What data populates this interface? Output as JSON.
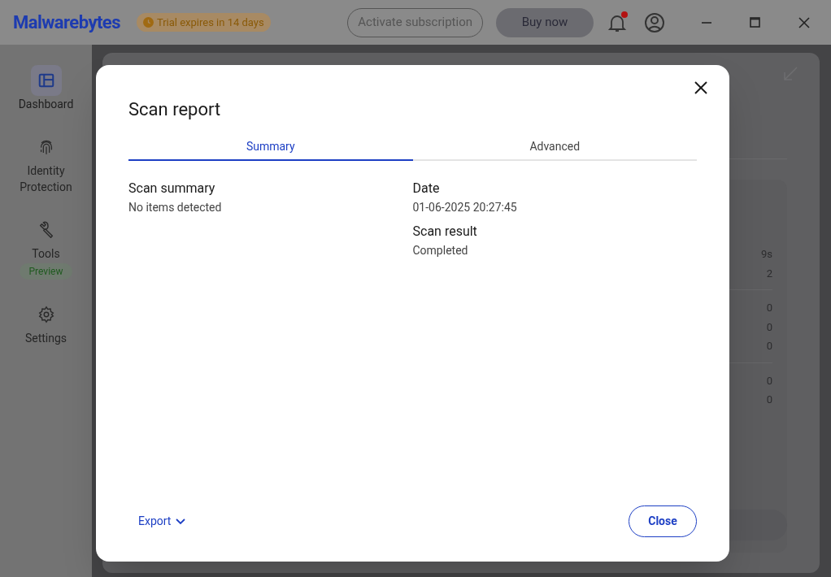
{
  "header": {
    "logo": "Malwarebytes",
    "trial_badge": "Trial expires in 14 days",
    "activate_button": "Activate subscription",
    "buy_button": "Buy now",
    "notification_unread": true
  },
  "sidebar": {
    "items": [
      {
        "label": "Dashboard",
        "kind": "dashboard",
        "selected": true
      },
      {
        "label": "Identity Protection",
        "kind": "identity",
        "selected": false
      },
      {
        "label": "Tools",
        "kind": "tools",
        "selected": false,
        "badge": "Preview"
      },
      {
        "label": "Settings",
        "kind": "settings",
        "selected": false
      }
    ]
  },
  "background_card": {
    "groups": [
      [
        "9s",
        "2"
      ],
      [
        "0",
        "0",
        "0"
      ],
      [
        "0",
        "0"
      ]
    ]
  },
  "dialog": {
    "title": "Scan report",
    "tabs": [
      {
        "label": "Summary",
        "selected": true
      },
      {
        "label": "Advanced",
        "selected": false
      }
    ],
    "columns": [
      [
        {
          "heading": "Scan summary",
          "value": "No items detected"
        }
      ],
      [
        {
          "heading": "Date",
          "value": "01-06-2025 20:27:45"
        },
        {
          "heading": "Scan result",
          "value": "Completed"
        }
      ]
    ],
    "export_button": "Export",
    "close_button": "Close"
  }
}
